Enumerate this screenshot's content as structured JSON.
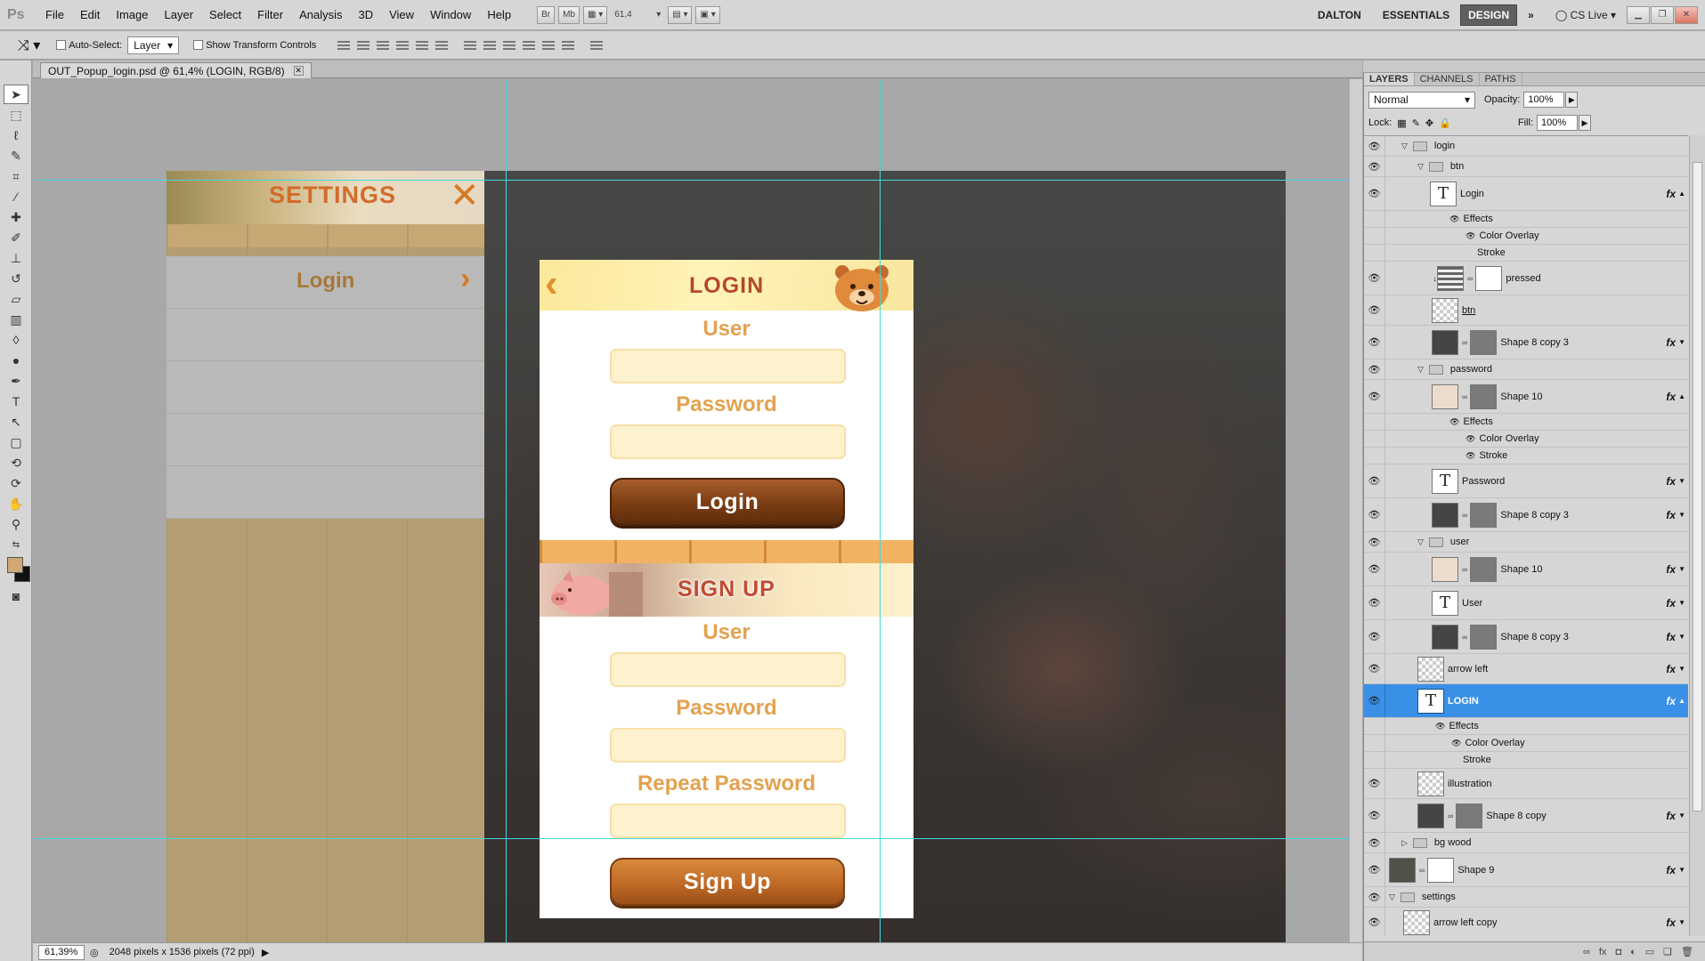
{
  "menubar": {
    "logo": "Ps",
    "items": [
      "File",
      "Edit",
      "Image",
      "Layer",
      "Select",
      "Filter",
      "Analysis",
      "3D",
      "View",
      "Window",
      "Help"
    ],
    "bridge": "Br",
    "minibridge": "Mb",
    "zoom": "61,4",
    "workspaces": [
      "DALTON",
      "ESSENTIALS",
      "DESIGN"
    ],
    "cslive": "CS Live"
  },
  "options": {
    "auto_select_label": "Auto-Select:",
    "auto_select_value": "Layer",
    "show_transform_label": "Show Transform Controls"
  },
  "document": {
    "tab_title": "OUT_Popup_login.psd @ 61,4% (LOGIN, RGB/8)",
    "settings_title": "SETTINGS",
    "settings_close": "✕",
    "settings_login": "Login",
    "settings_chevron": "›",
    "login_title": "LOGIN",
    "login_back": "‹",
    "login_user_label": "User",
    "login_password_label": "Password",
    "login_button": "Login",
    "signup_title": "SIGN UP",
    "signup_user_label": "User",
    "signup_password_label": "Password",
    "signup_repeat_label": "Repeat Password",
    "signup_button": "Sign Up"
  },
  "status": {
    "zoom": "61,39%",
    "doc_info": "2048 pixels x 1536 pixels (72 ppi)"
  },
  "layers": {
    "tabs": [
      "LAYERS",
      "CHANNELS",
      "PATHS"
    ],
    "blend_mode": "Normal",
    "opacity_label": "Opacity:",
    "opacity": "100%",
    "lock_label": "Lock:",
    "fill_label": "Fill:",
    "fill": "100%",
    "rows": [
      {
        "name": "login"
      },
      {
        "name": "btn"
      },
      {
        "name": "Login"
      },
      {
        "name": "Effects"
      },
      {
        "name": "Color Overlay"
      },
      {
        "name": "Stroke"
      },
      {
        "name": "pressed"
      },
      {
        "name": "btn"
      },
      {
        "name": "Shape 8 copy 3"
      },
      {
        "name": "password"
      },
      {
        "name": "Shape 10"
      },
      {
        "name": "Effects"
      },
      {
        "name": "Color Overlay"
      },
      {
        "name": "Stroke"
      },
      {
        "name": "Password"
      },
      {
        "name": "Shape 8 copy 3"
      },
      {
        "name": "user"
      },
      {
        "name": "Shape 10"
      },
      {
        "name": "User"
      },
      {
        "name": "Shape 8 copy 3"
      },
      {
        "name": "arrow left"
      },
      {
        "name": "LOGIN"
      },
      {
        "name": "Effects"
      },
      {
        "name": "Color Overlay"
      },
      {
        "name": "Stroke"
      },
      {
        "name": "illustration"
      },
      {
        "name": "Shape 8 copy"
      },
      {
        "name": "bg wood"
      },
      {
        "name": "Shape 9"
      },
      {
        "name": "settings"
      },
      {
        "name": "arrow left copy"
      }
    ],
    "fx_symbol": "fx"
  },
  "colors": {
    "accent_orange": "#e0902b",
    "selection_blue": "#3a90e6",
    "guide_cyan": "#44d7e0"
  }
}
